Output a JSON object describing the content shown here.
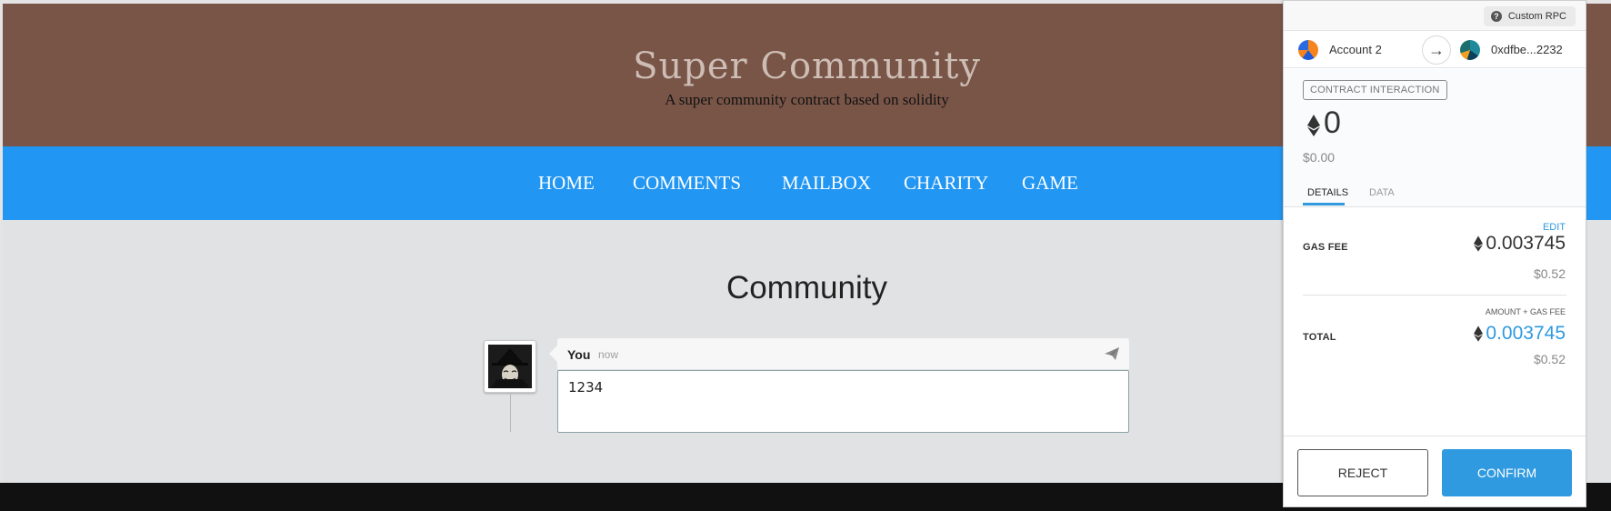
{
  "site": {
    "title": "Super Community",
    "subtitle": "A super community contract based on solidity"
  },
  "nav": {
    "items": [
      {
        "label": "HOME"
      },
      {
        "label": "COMMENTS"
      },
      {
        "label": "MAILBOX"
      },
      {
        "label": "CHARITY"
      },
      {
        "label": "GAME"
      }
    ]
  },
  "main": {
    "section_title": "Community",
    "comment": {
      "author": "You",
      "time": "now",
      "text": "1234"
    }
  },
  "metamask": {
    "network": "Custom RPC",
    "from_account": "Account 2",
    "to_address": "0xdfbe...2232",
    "action": "CONTRACT INTERACTION",
    "amount_eth": "0",
    "amount_fiat": "$0.00",
    "tabs": [
      {
        "label": "DETAILS",
        "active": true
      },
      {
        "label": "DATA",
        "active": false
      }
    ],
    "edit_label": "EDIT",
    "gas_fee": {
      "label": "GAS FEE",
      "eth": "0.003745",
      "fiat": "$0.52"
    },
    "subtotal_label": "AMOUNT + GAS FEE",
    "total": {
      "label": "TOTAL",
      "eth": "0.003745",
      "fiat": "$0.52"
    },
    "reject_label": "REJECT",
    "confirm_label": "CONFIRM"
  },
  "colors": {
    "header_bg": "#795548",
    "nav_bg": "#2196f3",
    "content_bg": "#e0e2e3",
    "accent": "#2f9ae0"
  }
}
